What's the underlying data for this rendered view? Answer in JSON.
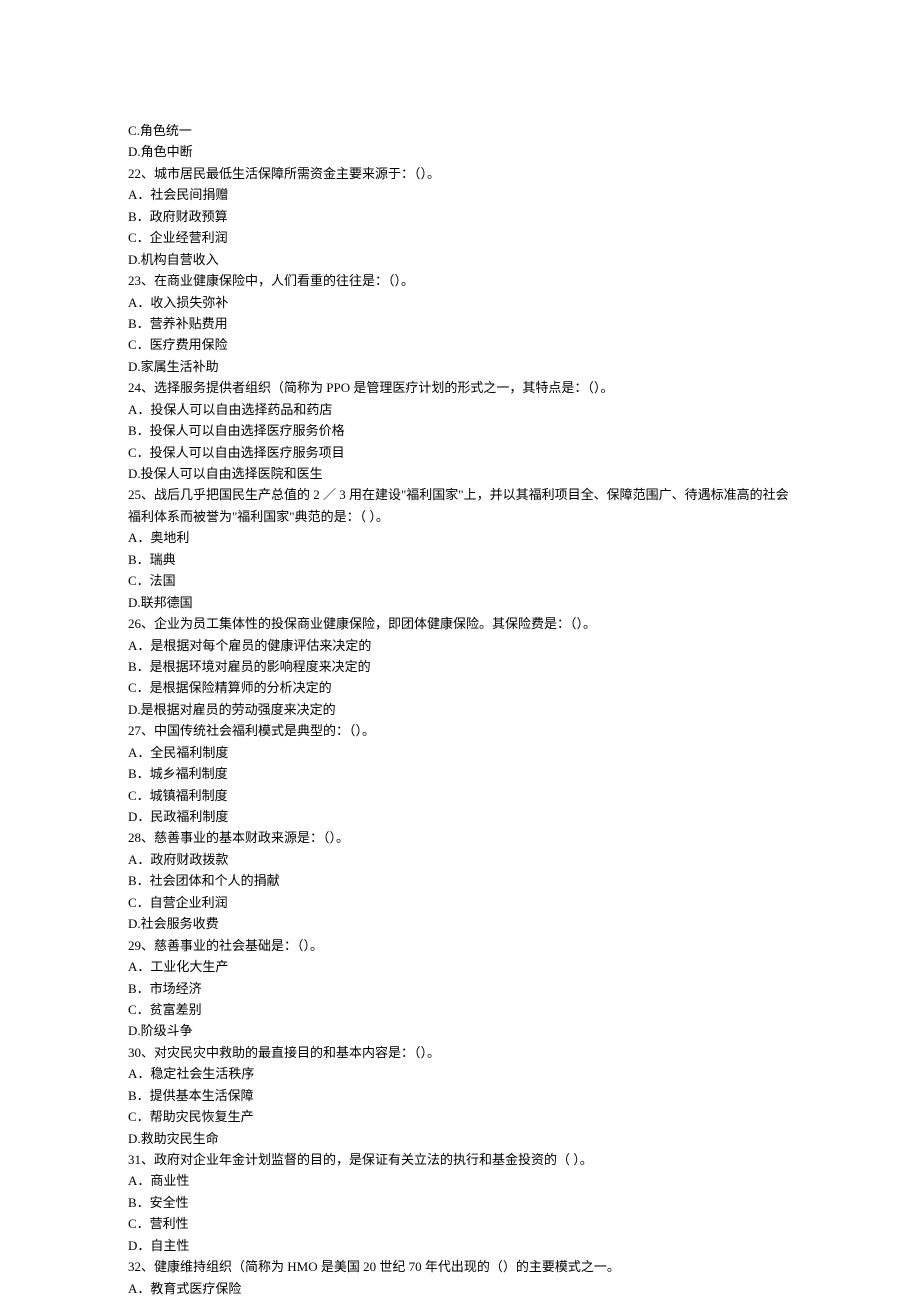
{
  "lines": [
    "C.角色统一",
    "D.角色中断",
    "22、城市居民最低生活保障所需资金主要来源于：（）。",
    "A．社会民间捐赠",
    "B．政府财政预算",
    "C．企业经营利润",
    "D.机构自营收入",
    "23、在商业健康保险中，人们看重的往往是：（）。",
    "A．收入损失弥补",
    "B．营养补贴费用",
    "C．医疗费用保险",
    "D.家属生活补助",
    "24、选择服务提供者组织（简称为 PPO 是管理医疗计划的形式之一，其特点是：（）。",
    "A．投保人可以自由选择药品和药店",
    "B．投保人可以自由选择医疗服务价格",
    "C．投保人可以自由选择医疗服务项目",
    "D.投保人可以自由选择医院和医生",
    "25、战后几乎把国民生产总值的 2 ／ 3 用在建设\"福利国家\"上，并以其福利项目全、保障范围广、待遇标准高的社会福利体系而被誉为\"福利国家\"典范的是：（ ）。",
    "A．奥地利",
    "B．瑞典",
    "C．法国",
    "D.联邦德国",
    "26、企业为员工集体性的投保商业健康保险，即团体健康保险。其保险费是：（）。",
    "A．是根据对每个雇员的健康评估来决定的",
    "B．是根据环境对雇员的影响程度来决定的",
    "C．是根据保险精算师的分析决定的",
    "D.是根据对雇员的劳动强度来决定的",
    "27、中国传统社会福利模式是典型的：（）。",
    "A．全民福利制度",
    "B．城乡福利制度",
    "C．城镇福利制度",
    "D．民政福利制度",
    "28、慈善事业的基本财政来源是：（）。",
    "A．政府财政拨款",
    "B．社会团体和个人的捐献",
    "C．自营企业利润",
    "D.社会服务收费",
    "29、慈善事业的社会基础是：（）。",
    "A．工业化大生产",
    "B．市场经济",
    "C．贫富差别",
    "D.阶级斗争",
    "30、对灾民灾中救助的最直接目的和基本内容是：（）。",
    "A．稳定社会生活秩序",
    "B．提供基本生活保障",
    "C．帮助灾民恢复生产",
    "D.救助灾民生命",
    "31、政府对企业年金计划监督的目的，是保证有关立法的执行和基金投资的（ ）。",
    "A．商业性",
    "B．安全性",
    "C．营利性",
    "D．自主性",
    "32、健康维持组织（简称为 HMO 是美国 20 世纪 70 年代出现的（）的主要模式之一。",
    "A．教育式医疗保险"
  ]
}
